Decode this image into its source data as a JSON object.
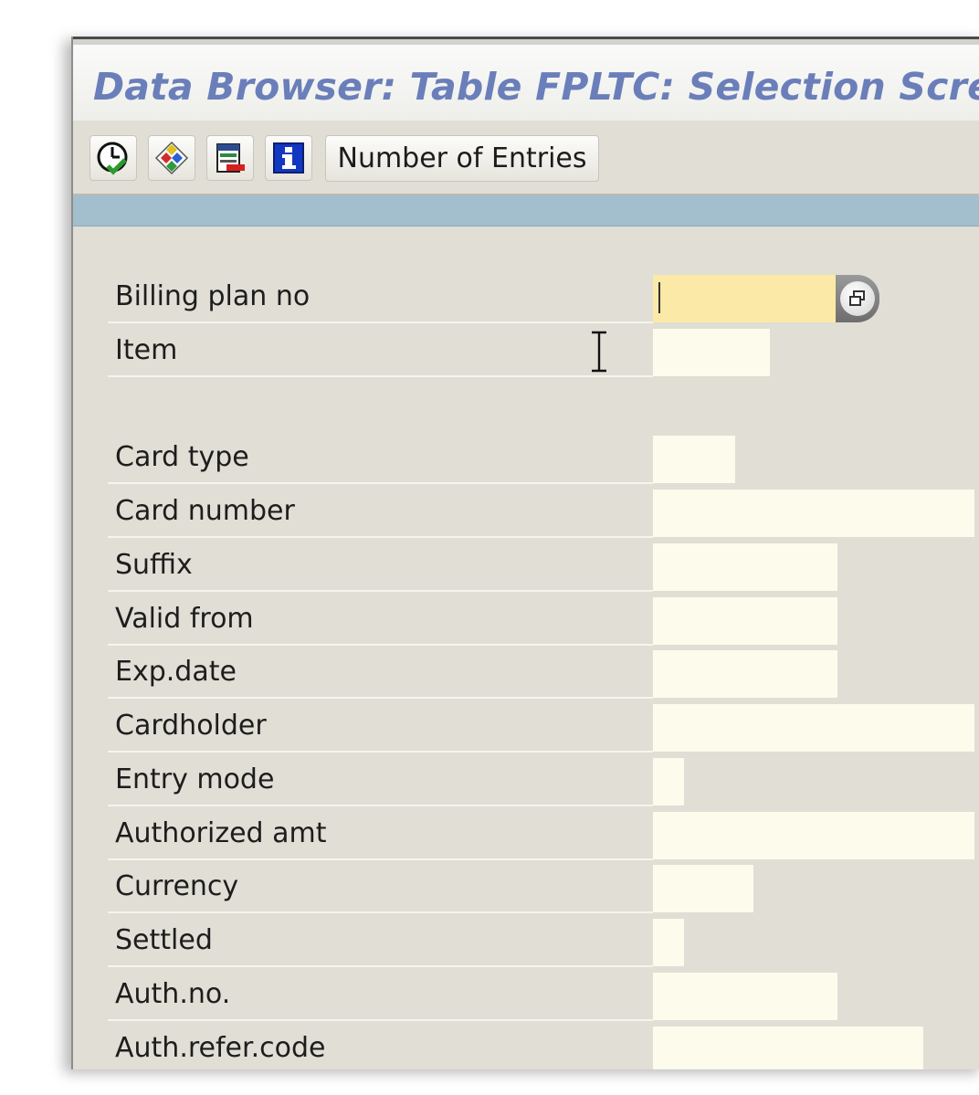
{
  "window": {
    "title": "Data Browser: Table FPLTC: Selection Screen"
  },
  "toolbar": {
    "buttons": [
      {
        "icon": "execute-clock-check-icon"
      },
      {
        "icon": "diamond-arrows-icon"
      },
      {
        "icon": "field-list-icon"
      },
      {
        "icon": "info-icon"
      }
    ],
    "number_of_entries_label": "Number of Entries"
  },
  "fields": [
    {
      "label": "Billing plan no",
      "value": "",
      "active": true,
      "has_search_help": true
    },
    {
      "label": "Item",
      "value": ""
    },
    {
      "label": "Card type",
      "value": ""
    },
    {
      "label": "Card number",
      "value": ""
    },
    {
      "label": "Suffix",
      "value": ""
    },
    {
      "label": "Valid from",
      "value": ""
    },
    {
      "label": "Exp.date",
      "value": ""
    },
    {
      "label": "Cardholder",
      "value": ""
    },
    {
      "label": "Entry mode",
      "value": ""
    },
    {
      "label": "Authorized amt",
      "value": ""
    },
    {
      "label": "Currency",
      "value": ""
    },
    {
      "label": "Settled",
      "value": ""
    },
    {
      "label": "Auth.no.",
      "value": ""
    },
    {
      "label": "Auth.refer.code",
      "value": ""
    }
  ],
  "colors": {
    "title": "#6a7fba",
    "window_bg": "#e0ded5",
    "status_bar": "#a3bfcd",
    "input_bg": "#fcfbec",
    "active_input_bg": "#fbe9a8"
  }
}
